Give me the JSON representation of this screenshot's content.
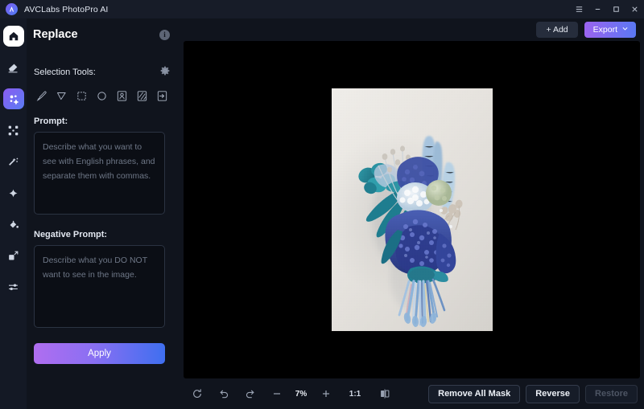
{
  "titlebar": {
    "app_name": "AVCLabs PhotoPro AI",
    "logo_icon": "avclabs-logo-icon",
    "menu_icon": "hamburger-menu-icon",
    "minimize_icon": "minimize-icon",
    "maximize_icon": "maximize-icon",
    "close_icon": "close-icon"
  },
  "rail": {
    "items": [
      {
        "name": "home",
        "icon": "home-icon",
        "active": false,
        "home": true
      },
      {
        "name": "erase",
        "icon": "eraser-icon",
        "active": false
      },
      {
        "name": "replace",
        "icon": "magic-replace-icon",
        "active": true
      },
      {
        "name": "expand",
        "icon": "expand-corners-icon",
        "active": false
      },
      {
        "name": "retouch",
        "icon": "magic-wand-icon",
        "active": false
      },
      {
        "name": "enhance",
        "icon": "sparkle-icon",
        "active": false
      },
      {
        "name": "colorize",
        "icon": "paint-drop-icon",
        "active": false
      },
      {
        "name": "upscale",
        "icon": "upscale-arrow-icon",
        "active": false
      },
      {
        "name": "adjust",
        "icon": "sliders-icon",
        "active": false
      }
    ]
  },
  "panel": {
    "title": "Replace",
    "info_icon": "info-icon",
    "selection_label": "Selection Tools:",
    "settings_icon": "gear-icon",
    "tools": [
      {
        "name": "brush",
        "icon": "brush-icon"
      },
      {
        "name": "lasso",
        "icon": "lasso-pointer-icon"
      },
      {
        "name": "rectangle",
        "icon": "rectangle-select-icon"
      },
      {
        "name": "ellipse",
        "icon": "ellipse-select-icon"
      },
      {
        "name": "subject",
        "icon": "select-subject-icon"
      },
      {
        "name": "background",
        "icon": "select-background-icon"
      },
      {
        "name": "import-mask",
        "icon": "import-mask-icon"
      }
    ],
    "prompt_label": "Prompt:",
    "prompt_placeholder": "Describe what you want to see with English phrases, and separate them with commas.",
    "prompt_value": "",
    "negative_prompt_label": "Negative Prompt:",
    "negative_prompt_placeholder": "Describe what you DO NOT want to see in the image.",
    "negative_prompt_value": "",
    "apply_label": "Apply"
  },
  "main": {
    "add_label": "+ Add",
    "export_label": "Export",
    "export_chevron": "chevron-down-icon",
    "image_alt": "dried blue flower bouquet on light beige background"
  },
  "bottombar": {
    "reset_icon": "reset-rotate-icon",
    "undo_icon": "undo-icon",
    "redo_icon": "redo-icon",
    "zoom_out_icon": "minus-icon",
    "zoom_level": "7%",
    "zoom_in_icon": "plus-icon",
    "fit_ratio": "1:1",
    "compare_icon": "compare-split-icon",
    "remove_all_mask_label": "Remove All Mask",
    "reverse_label": "Reverse",
    "restore_label": "Restore"
  },
  "colors": {
    "accent_purple": "#8a5cf0",
    "accent_blue": "#3f6ff0",
    "panel_bg": "#10141d",
    "rail_bg": "#141925",
    "titlebar_bg": "#171c28",
    "canvas_bg": "#000000"
  }
}
